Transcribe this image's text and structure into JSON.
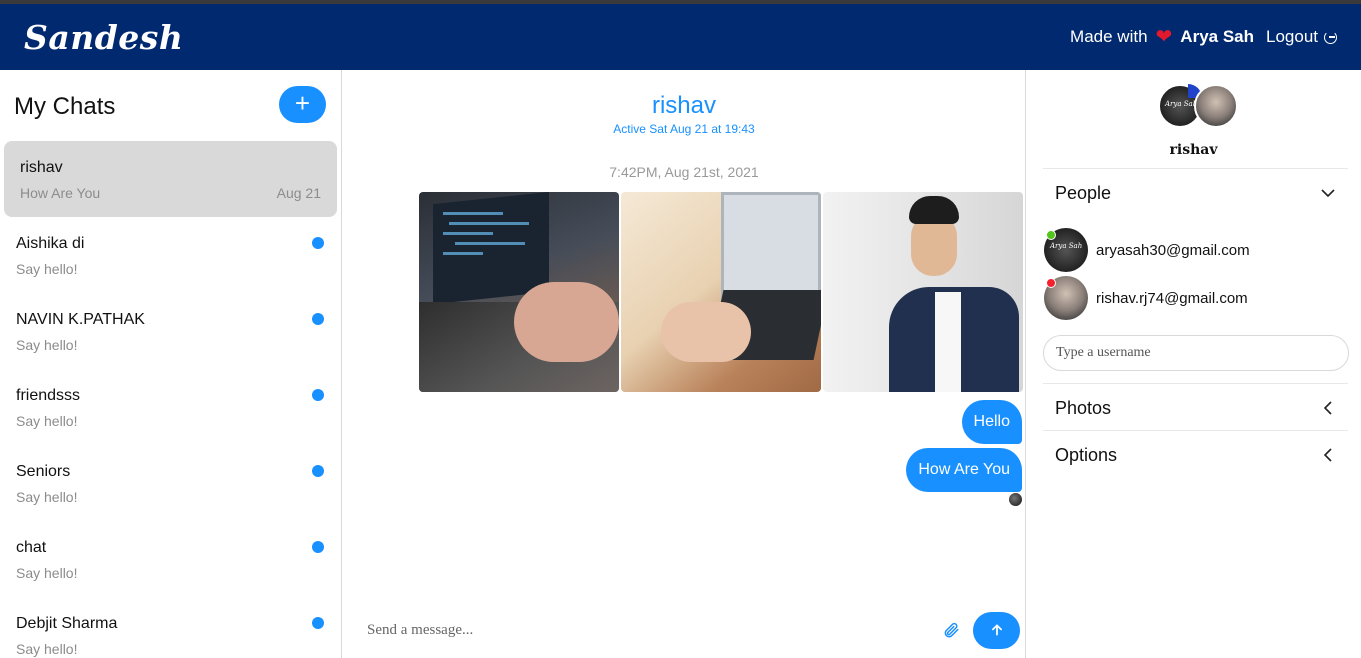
{
  "navbar": {
    "brand": "Sandesh",
    "made_with": "Made with",
    "heart": "❤",
    "author": "Arya Sah",
    "logout": "Logout"
  },
  "chats_panel": {
    "title": "My Chats",
    "add_label": "+",
    "items": [
      {
        "name": "rishav",
        "preview": "How Are You",
        "date": "Aug 21",
        "active": true,
        "unread": false
      },
      {
        "name": "Aishika di",
        "preview": "Say hello!",
        "unread": true
      },
      {
        "name": "NAVIN K.PATHAK",
        "preview": "Say hello!",
        "unread": true
      },
      {
        "name": "friendsss",
        "preview": "Say hello!",
        "unread": true
      },
      {
        "name": "Seniors",
        "preview": "Say hello!",
        "unread": true
      },
      {
        "name": "chat",
        "preview": "Say hello!",
        "unread": true
      },
      {
        "name": "Debjit Sharma",
        "preview": "Say hello!",
        "unread": true
      }
    ]
  },
  "conversation": {
    "title": "rishav",
    "status": "Active Sat Aug 21 at 19:43",
    "timestamp": "7:42PM, Aug 21st, 2021",
    "photos": [
      "laptop-typing-photo",
      "tablet-browsing-photo",
      "man-in-suit-photo"
    ],
    "messages": [
      {
        "text": "Hello",
        "own": true
      },
      {
        "text": "How Are You",
        "own": true
      }
    ],
    "composer": {
      "placeholder": "Send a message..."
    }
  },
  "details_panel": {
    "group_name": "rishav",
    "sections": {
      "people": "People",
      "photos": "Photos",
      "options": "Options"
    },
    "people": [
      {
        "email": "aryasah30@gmail.com",
        "status": "online"
      },
      {
        "email": "rishav.rj74@gmail.com",
        "status": "offline"
      }
    ],
    "username_placeholder": "Type a username"
  },
  "colors": {
    "navbar": "#002970",
    "accent": "#1890ff",
    "active_chat": "#d9d9d9",
    "online": "#52c41a",
    "offline": "#f5222d"
  }
}
